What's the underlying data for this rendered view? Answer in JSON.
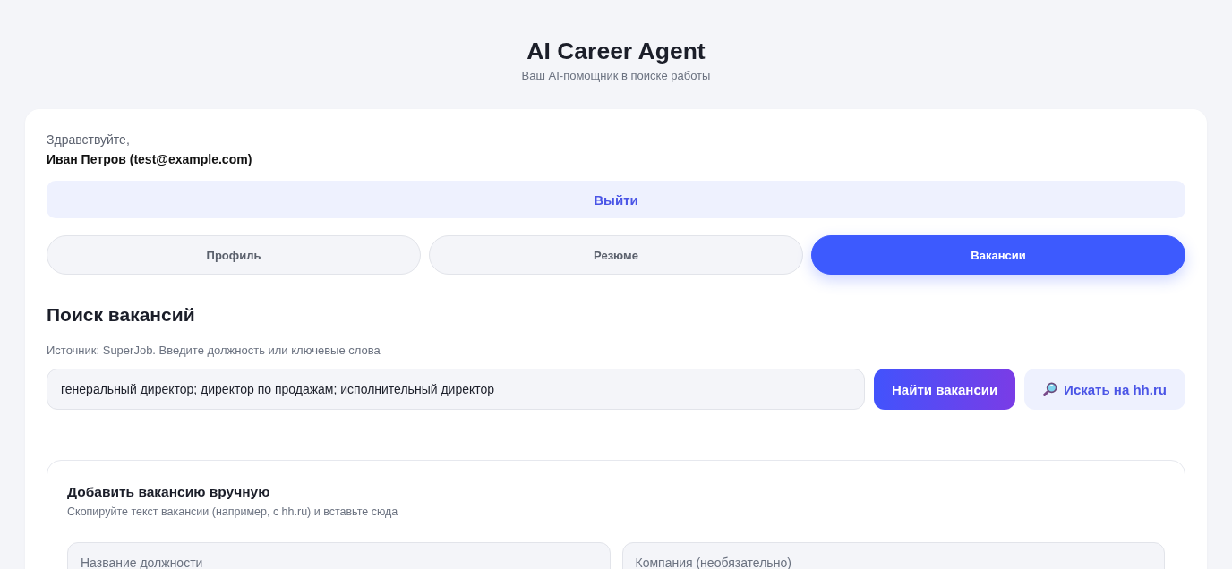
{
  "header": {
    "title": "AI Career Agent",
    "subtitle": "Ваш AI-помощник в поиске работы"
  },
  "user": {
    "greeting": "Здравствуйте,",
    "name": "Иван Петров (test@example.com)"
  },
  "logout_button": {
    "label": "Выйти"
  },
  "tabs": [
    {
      "label": "Профиль",
      "selected": false
    },
    {
      "label": "Резюме",
      "selected": false
    },
    {
      "label": "Вакансии",
      "selected": true
    }
  ],
  "search": {
    "title": "Поиск вакансий",
    "hint": "Источник: SuperJob. Введите должность или ключевые слова",
    "value": "генеральный директор; директор по продажам; исполнительный директор",
    "buttons": [
      {
        "kind": "primary",
        "label": "Найти вакансии"
      },
      {
        "kind": "external",
        "label": "Искать на hh.ru"
      }
    ]
  },
  "manual": {
    "title": "Добавить вакансию вручную",
    "subtitle": "Скопируйте текст вакансии (например, с hh.ru) и вставьте сюда",
    "fields": [
      {
        "placeholder": "Название должности"
      },
      {
        "placeholder": "Компания (необязательно)"
      }
    ]
  }
}
